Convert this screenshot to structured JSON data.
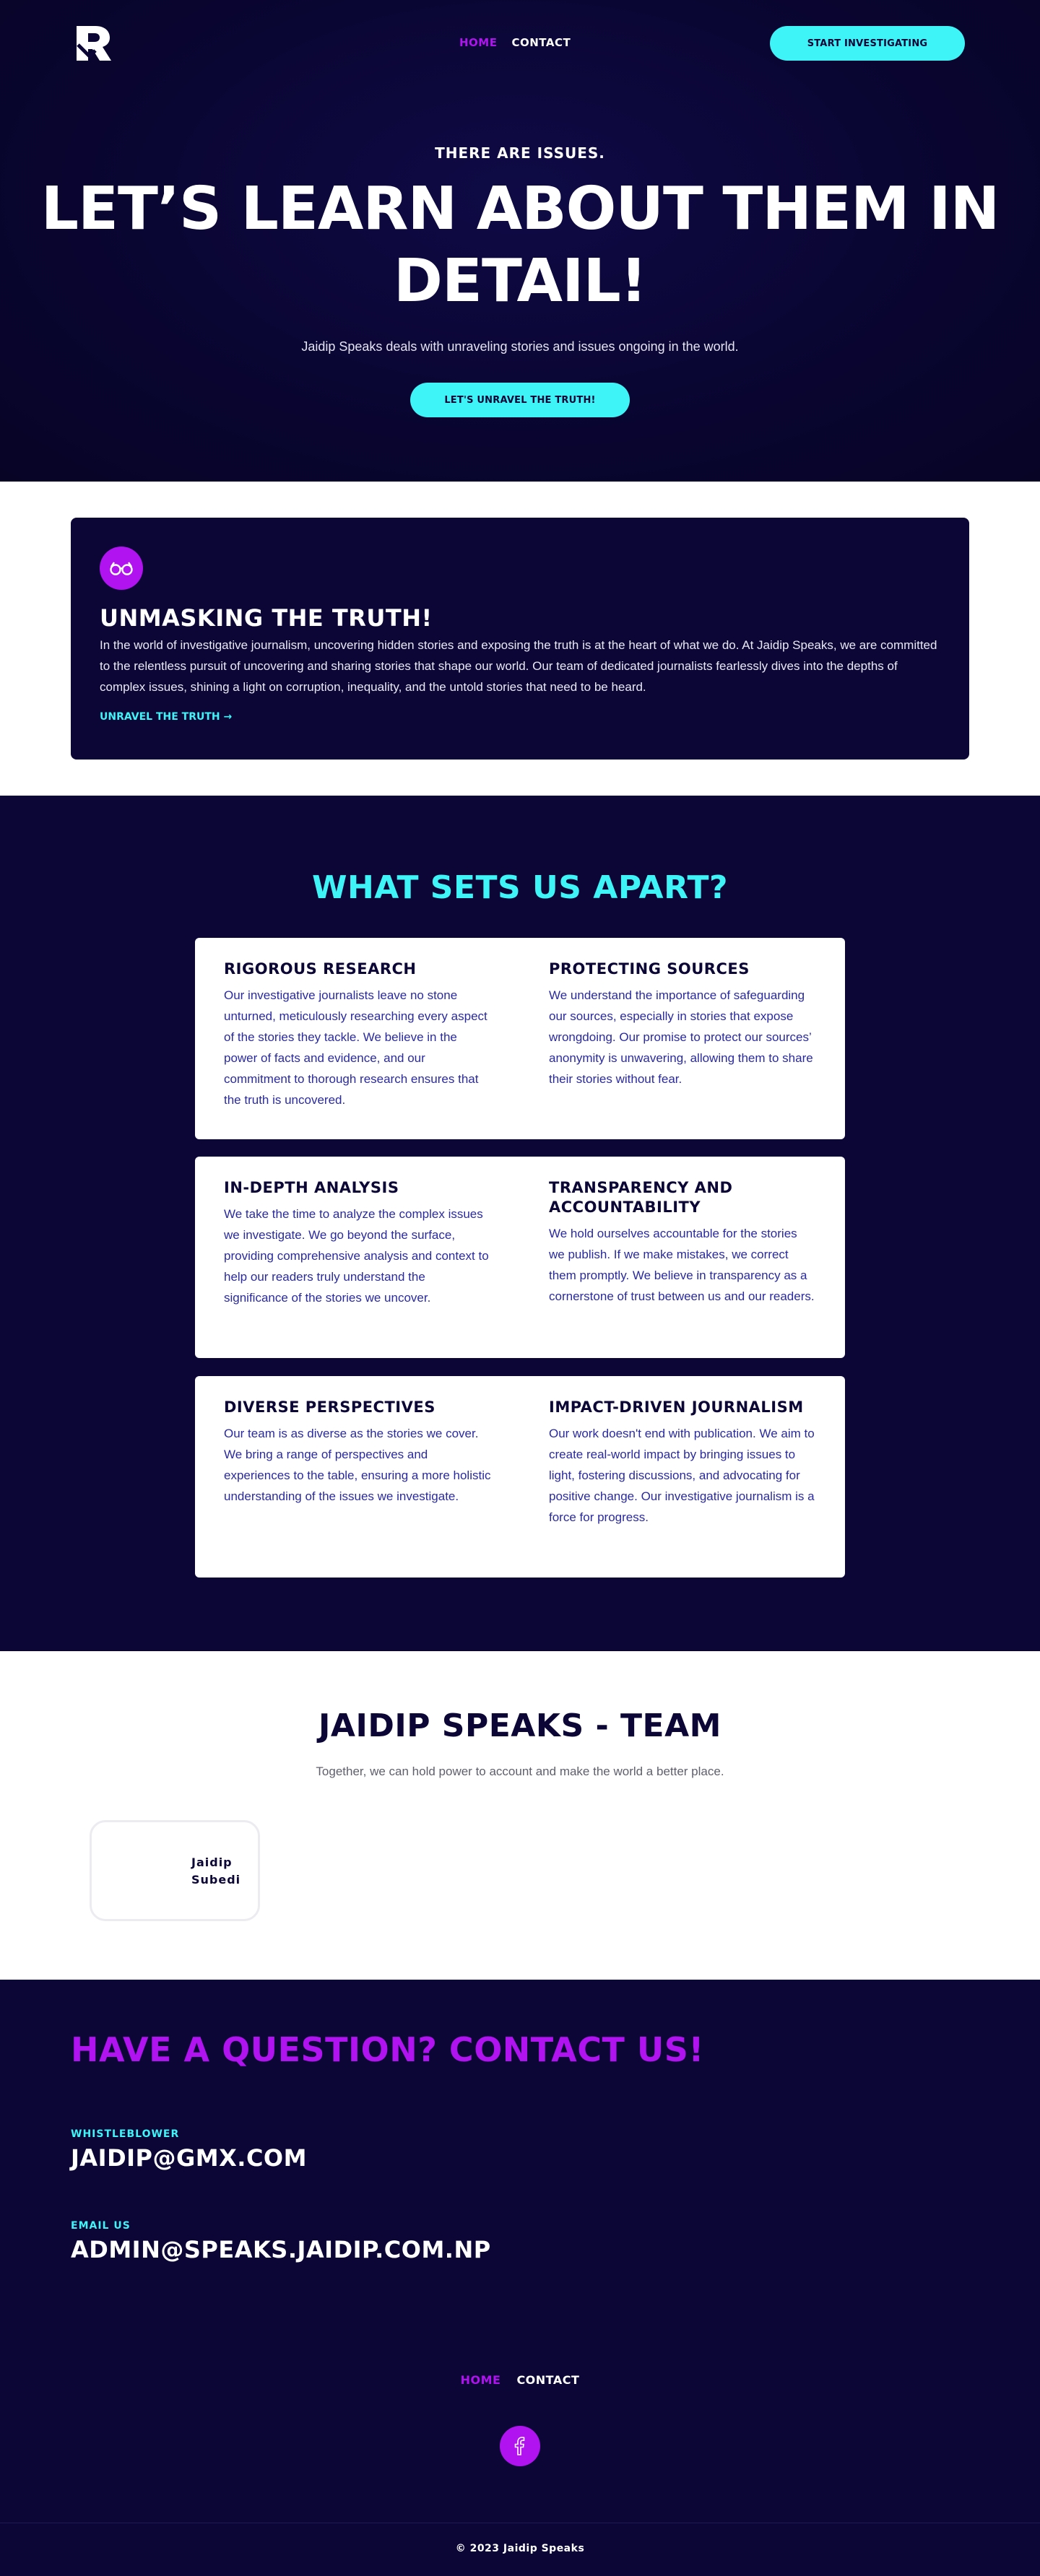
{
  "nav": {
    "links": [
      "HOME",
      "CONTACT"
    ],
    "cta": "START INVESTIGATING"
  },
  "hero": {
    "kicker": "THERE ARE ISSUES.",
    "title": "LET’S LEARN ABOUT THEM IN DETAIL!",
    "subtitle": "Jaidip Speaks deals with unraveling stories and issues ongoing in the world.",
    "cta": "LET'S UNRAVEL THE TRUTH!"
  },
  "unmasking": {
    "title": "UNMASKING THE TRUTH!",
    "text": "In the world of investigative journalism, uncovering hidden stories and exposing the truth is at the heart of what we do. At Jaidip Speaks, we are committed to the relentless pursuit of uncovering and sharing stories that shape our world. Our team of dedicated journalists fearlessly dives into the depths of complex issues, shining a light on corruption, inequality, and the untold stories that need to be heard.",
    "link": "UNRAVEL THE TRUTH →"
  },
  "apart": {
    "title": "WHAT SETS US APART?",
    "features": [
      {
        "title": "RIGOROUS RESEARCH",
        "text": "Our investigative journalists leave no stone unturned, meticulously researching every aspect of the stories they tackle. We believe in the power of facts and evidence, and our commitment to thorough research ensures that the truth is uncovered."
      },
      {
        "title": "PROTECTING SOURCES",
        "text": "We understand the importance of safeguarding our sources, especially in stories that expose wrongdoing. Our promise to protect our sources’ anonymity is unwavering, allowing them to share their stories without fear."
      },
      {
        "title": "IN-DEPTH ANALYSIS",
        "text": "We take the time to analyze the complex issues we investigate. We go beyond the surface, providing comprehensive analysis and context to help our readers truly understand the significance of the stories we uncover."
      },
      {
        "title": "TRANSPARENCY AND ACCOUNTABILITY",
        "text": "We hold ourselves accountable for the stories we publish. If we make mistakes, we correct them promptly. We believe in transparency as a cornerstone of trust between us and our readers."
      },
      {
        "title": "DIVERSE PERSPECTIVES",
        "text": "Our team is as diverse as the stories we cover. We bring a range of perspectives and experiences to the table, ensuring a more holistic understanding of the issues we investigate."
      },
      {
        "title": "IMPACT-DRIVEN JOURNALISM",
        "text": "Our work doesn't end with publication. We aim to create real-world impact by bringing issues to light, fostering discussions, and advocating for positive change. Our investigative journalism is a force for progress."
      }
    ]
  },
  "team": {
    "title": "JAIDIP SPEAKS - TEAM",
    "subtitle": "Together, we can hold power to account and make the world a better place.",
    "members": [
      "Jaidip Subedi"
    ]
  },
  "contact": {
    "title": "HAVE A QUESTION? CONTACT US!",
    "items": [
      {
        "label": "WHISTLEBLOWER",
        "value": "JAIDIP@GMX.COM"
      },
      {
        "label": "EMAIL US",
        "value": "ADMIN@SPEAKS.JAIDIP.COM.NP"
      }
    ]
  },
  "footer": {
    "links": [
      "HOME",
      "CONTACT"
    ],
    "social_icon": "facebook-icon",
    "copyright": "© 2023 Jaidip Speaks"
  },
  "colors": {
    "navy": "#0b0636",
    "cyan": "#3ef4f7",
    "purple": "#b012f0",
    "feature_text": "#2a2aa0"
  }
}
